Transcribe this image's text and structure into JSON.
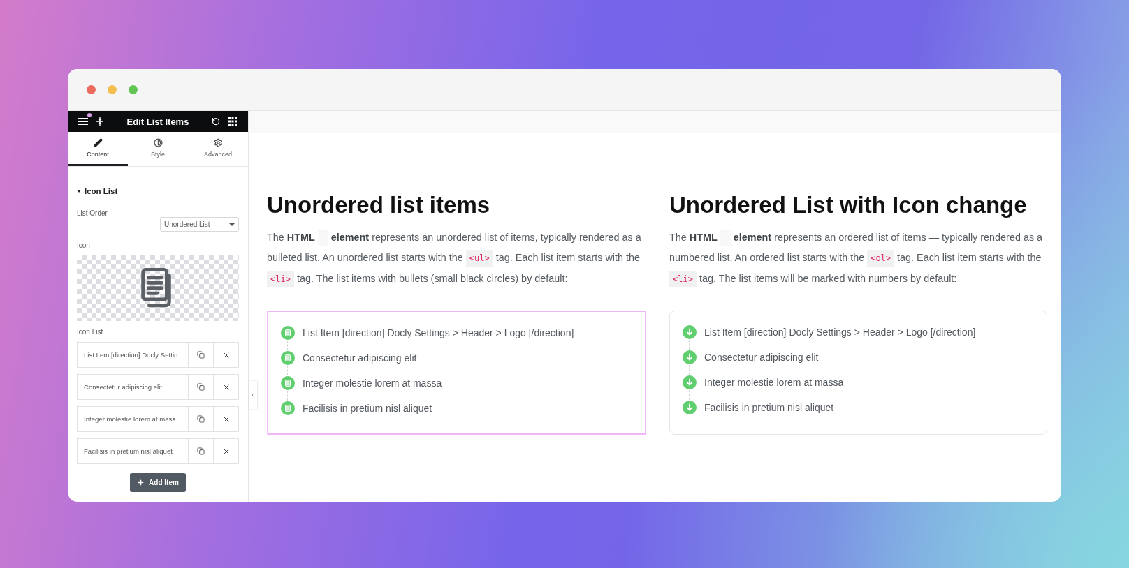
{
  "sidebar": {
    "title": "Edit List Items",
    "notification": true,
    "tabs": [
      {
        "label": "Content",
        "kind": "pencil",
        "selected": true
      },
      {
        "label": "Style",
        "kind": "contrast",
        "selected": false
      },
      {
        "label": "Advanced",
        "kind": "gear",
        "selected": false
      }
    ],
    "section": {
      "title": "Icon List",
      "expanded": true
    },
    "list_order": {
      "label": "List Order",
      "value": "Unordered List"
    },
    "icon": {
      "label": "Icon"
    },
    "items_label": "Icon List",
    "items": [
      "List Item [direction] Docly Settin",
      "Consectetur adipiscing elit",
      "Integer molestie lorem at mass",
      "Facilisis in pretium nisl aliquet"
    ],
    "add_button": "Add Item"
  },
  "main": {
    "columns": [
      {
        "heading": "Unordered list items",
        "selected": true,
        "kind": "document",
        "paragraph": [
          {
            "kind": "text",
            "text": "The **HTML** "
          },
          {
            "kind": "blank"
          },
          {
            "kind": "text",
            "text": " **element** represents an unordered list of items, typically rendered as a bulleted list. An unordered list starts with the "
          },
          {
            "kind": "code",
            "text": "<ul>"
          },
          {
            "kind": "text",
            "text": " tag. Each list item starts with the "
          },
          {
            "kind": "code",
            "text": "<li>"
          },
          {
            "kind": "text",
            "text": " tag. The list items  with bullets (small black circles) by default:"
          }
        ],
        "items": [
          "List Item [direction] Docly Settings > Header > Logo [/direction]",
          "Consectetur adipiscing elit",
          "Integer molestie lorem at massa",
          "Facilisis in pretium nisl aliquet"
        ]
      },
      {
        "heading": "Unordered List with Icon change",
        "selected": false,
        "kind": "arrow",
        "paragraph": [
          {
            "kind": "text",
            "text": "The **HTML** "
          },
          {
            "kind": "blank"
          },
          {
            "kind": "text",
            "text": " **element** represents an ordered list of items — typically rendered as a numbered list. An ordered list starts with the "
          },
          {
            "kind": "code",
            "text": "<ol>"
          },
          {
            "kind": "text",
            "text": " tag. Each list item starts with the "
          },
          {
            "kind": "code",
            "text": "<li>"
          },
          {
            "kind": "text",
            "text": " tag. The list items will be marked with numbers by default:"
          }
        ],
        "items": [
          "List Item [direction] Docly Settings > Header > Logo [/direction]",
          "Consectetur adipiscing elit",
          "Integer molestie lorem at massa",
          "Facilisis in pretium nisl aliquet"
        ]
      }
    ]
  }
}
